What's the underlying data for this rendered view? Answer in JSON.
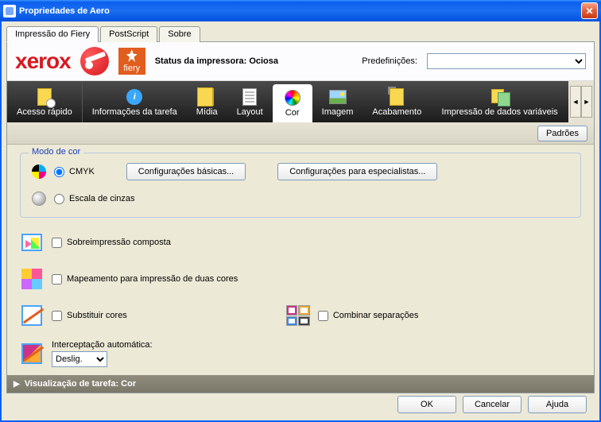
{
  "window": {
    "title": "Propriedades de Aero"
  },
  "tabs": {
    "items": [
      "Impressão do Fiery",
      "PostScript",
      "Sobre"
    ],
    "active": 0
  },
  "header": {
    "brand": "xerox",
    "fiery": "fiery",
    "status_label": "Status da impressora:",
    "status_value": "Ociosa",
    "predef_label": "Predefinições:"
  },
  "toolbar": {
    "items": [
      {
        "id": "quick",
        "label": "Acesso rápido"
      },
      {
        "id": "info",
        "label": "Informações da tarefa"
      },
      {
        "id": "media",
        "label": "Mídia"
      },
      {
        "id": "layout",
        "label": "Layout"
      },
      {
        "id": "color",
        "label": "Cor"
      },
      {
        "id": "image",
        "label": "Imagem"
      },
      {
        "id": "finish",
        "label": "Acabamento"
      },
      {
        "id": "vdp",
        "label": "Impressão de dados variáveis"
      }
    ],
    "active": "color",
    "padroes": "Padrões"
  },
  "color_panel": {
    "group_title": "Modo de cor",
    "cmyk_label": "CMYK",
    "gray_label": "Escala de cinzas",
    "basic_btn": "Configurações básicas...",
    "expert_btn": "Configurações para especialistas...",
    "composite_label": "Sobreimpressão composta",
    "mapping_label": "Mapeamento para impressão de duas cores",
    "subst_label": "Substituir cores",
    "combine_label": "Combinar separações",
    "trap_label": "Interceptação automática:",
    "trap_value": "Deslig."
  },
  "preview_bar": "Visualização de tarefa: Cor",
  "footer": {
    "ok": "OK",
    "cancel": "Cancelar",
    "help": "Ajuda"
  }
}
